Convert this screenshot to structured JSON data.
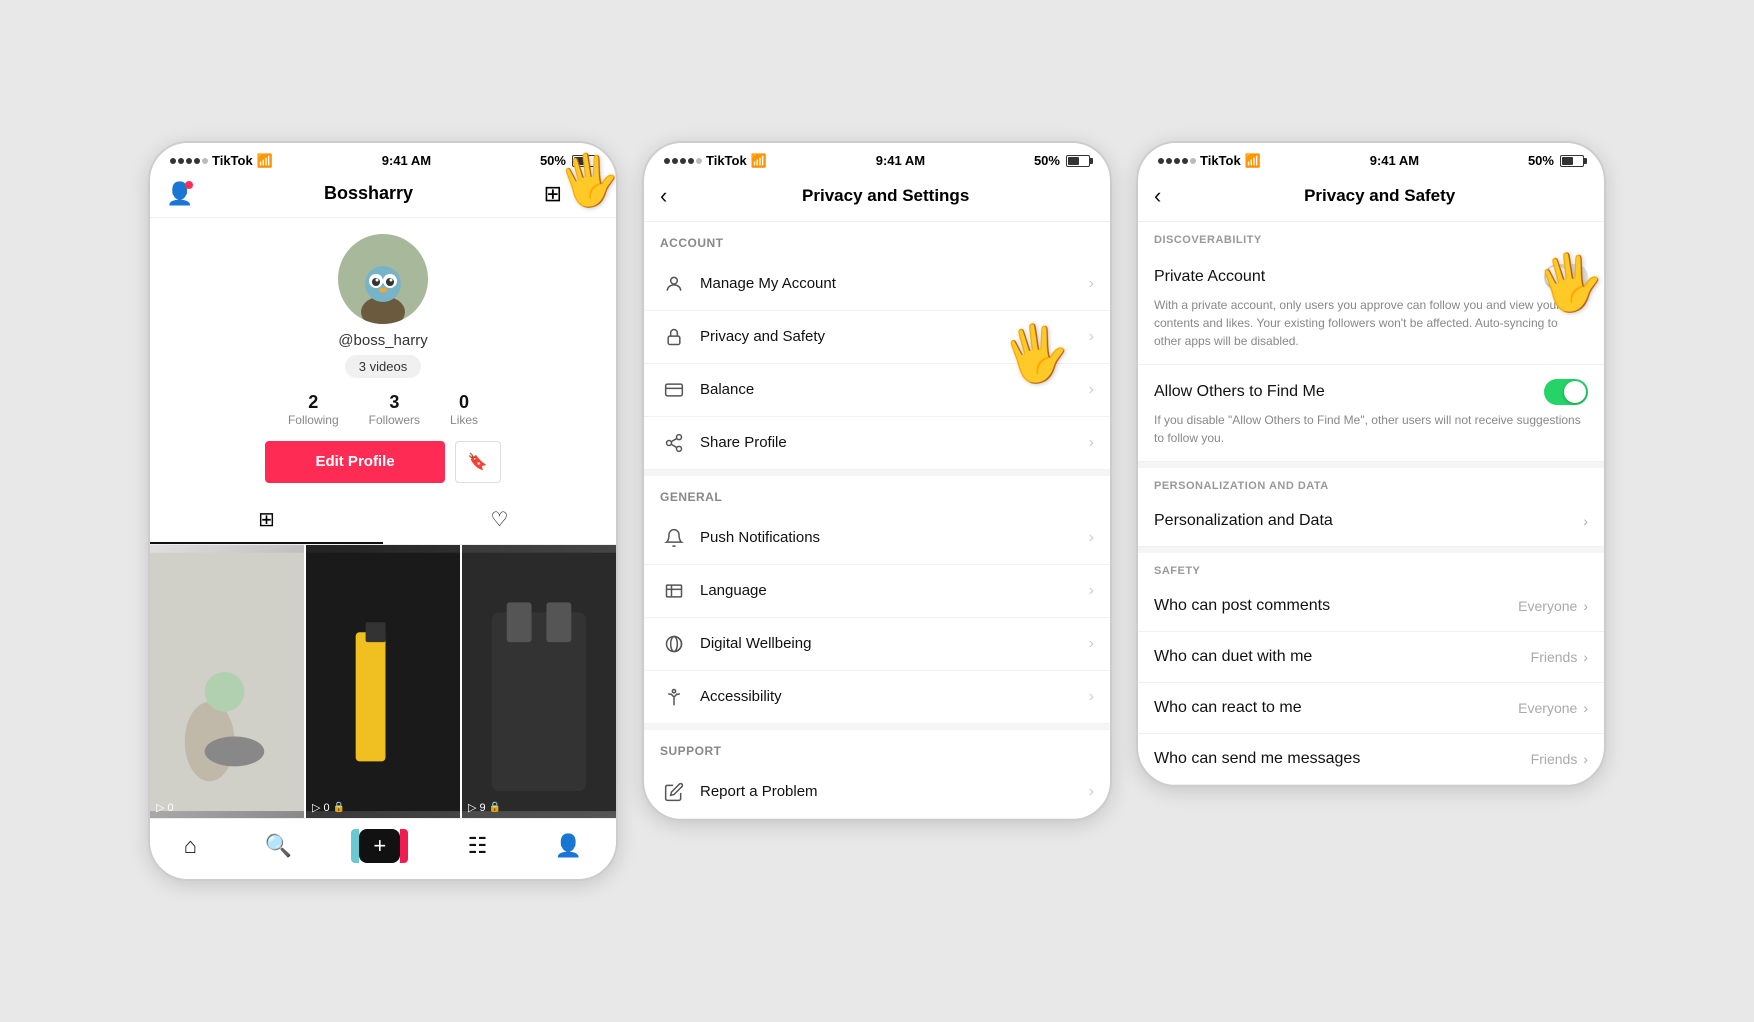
{
  "screen1": {
    "statusBar": {
      "carrier": "TikTok",
      "time": "9:41 AM",
      "battery": "50%"
    },
    "username": "Bossharry",
    "handle": "@boss_harry",
    "videoCount": "3 videos",
    "stats": {
      "following": {
        "count": "2",
        "label": "Following"
      },
      "followers": {
        "count": "3",
        "label": "Followers"
      },
      "likes": {
        "count": "0",
        "label": "Likes"
      }
    },
    "editProfileLabel": "Edit Profile",
    "tabs": {
      "grid": "|||",
      "likes": "♡"
    },
    "videos": [
      {
        "count": "0",
        "lock": false
      },
      {
        "count": "0",
        "lock": true
      },
      {
        "count": "9",
        "lock": true
      }
    ],
    "bottomNav": {
      "home": "⌂",
      "search": "🔍",
      "plus": "+",
      "inbox": "💬",
      "profile": "👤"
    }
  },
  "screen2": {
    "statusBar": {
      "carrier": "TikTok",
      "time": "9:41 AM",
      "battery": "50%"
    },
    "title": "Privacy and Settings",
    "sections": {
      "account": {
        "label": "ACCOUNT",
        "items": [
          {
            "icon": "person",
            "label": "Manage My Account"
          },
          {
            "icon": "lock",
            "label": "Privacy and Safety"
          },
          {
            "icon": "balance",
            "label": "Balance"
          },
          {
            "icon": "share",
            "label": "Share Profile"
          }
        ]
      },
      "general": {
        "label": "GENERAL",
        "items": [
          {
            "icon": "bell",
            "label": "Push Notifications"
          },
          {
            "icon": "A",
            "label": "Language"
          },
          {
            "icon": "wellbeing",
            "label": "Digital Wellbeing"
          },
          {
            "icon": "accessibility",
            "label": "Accessibility"
          }
        ]
      },
      "support": {
        "label": "SUPPORT",
        "items": [
          {
            "icon": "pencil",
            "label": "Report a Problem"
          }
        ]
      }
    }
  },
  "screen3": {
    "statusBar": {
      "carrier": "TikTok",
      "time": "9:41 AM",
      "battery": "50%"
    },
    "title": "Privacy and Safety",
    "sections": {
      "discoverability": {
        "label": "DISCOVERABILITY",
        "items": [
          {
            "type": "toggle",
            "label": "Private Account",
            "desc": "With a private account, only users you approve can follow you and view your contents and likes. Your existing followers won't be affected. Auto-syncing to other apps will be disabled.",
            "state": "off"
          },
          {
            "type": "toggle",
            "label": "Allow Others to Find Me",
            "desc": "If you disable \"Allow Others to Find Me\", other users will not receive suggestions to follow you.",
            "state": "on"
          }
        ]
      },
      "personalization": {
        "label": "PERSONALIZATION AND DATA",
        "items": [
          {
            "type": "nav",
            "label": "Personalization and Data",
            "value": ""
          }
        ]
      },
      "safety": {
        "label": "SAFETY",
        "items": [
          {
            "type": "nav",
            "label": "Who can post comments",
            "value": "Everyone"
          },
          {
            "type": "nav",
            "label": "Who can duet with me",
            "value": "Friends"
          },
          {
            "type": "nav",
            "label": "Who can react to me",
            "value": "Everyone"
          },
          {
            "type": "nav",
            "label": "Who can send me messages",
            "value": "Friends"
          }
        ]
      }
    }
  }
}
